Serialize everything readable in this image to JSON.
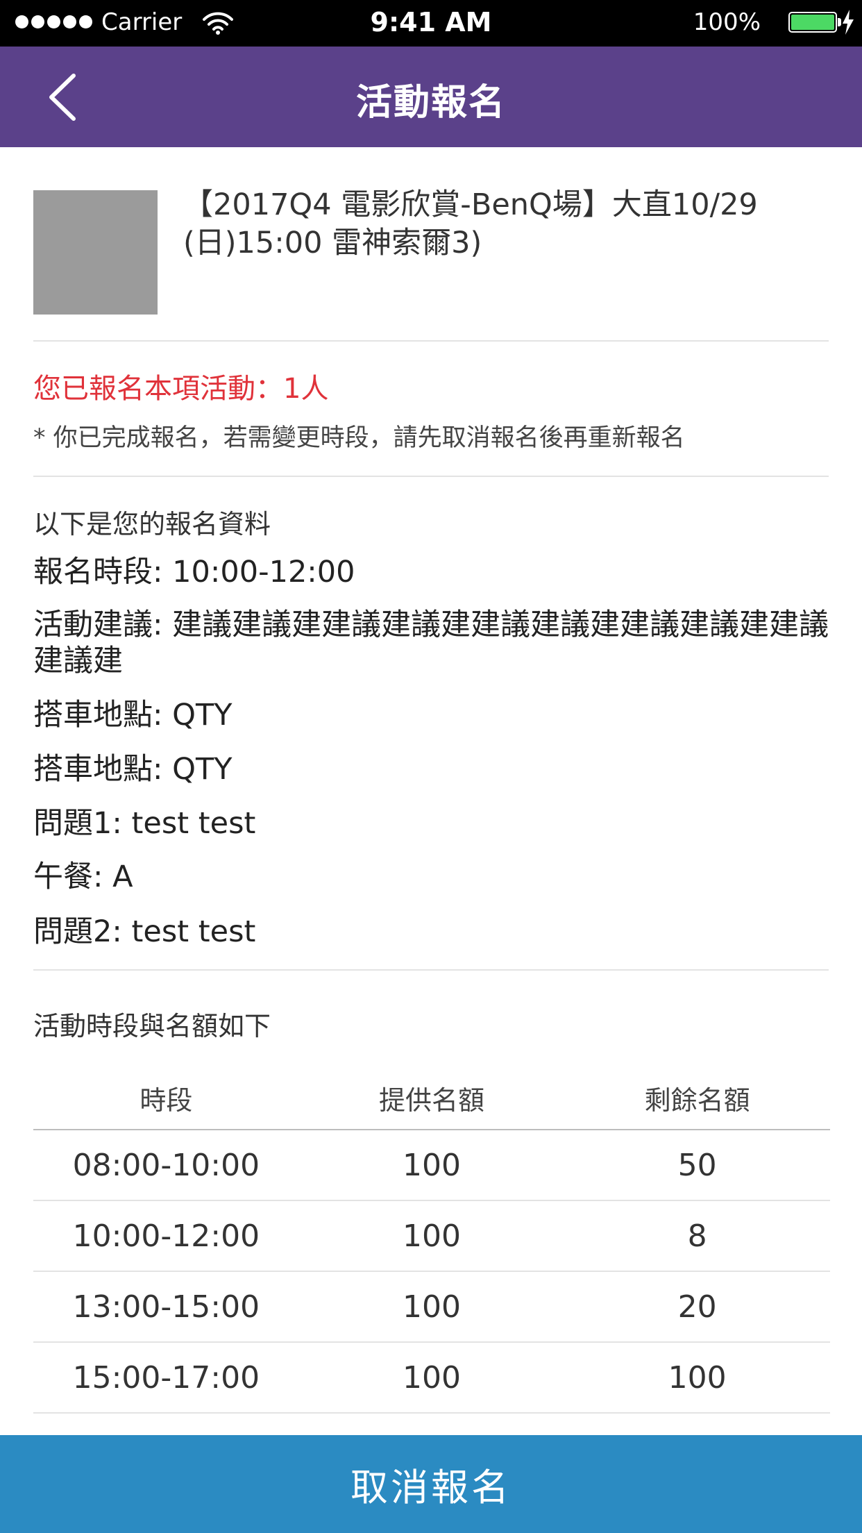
{
  "status_bar": {
    "carrier": "Carrier",
    "time": "9:41 AM",
    "battery": "100%"
  },
  "nav": {
    "title": "活動報名",
    "back_icon": "chevron-left-icon"
  },
  "event": {
    "title": "【2017Q4 電影欣賞-BenQ場】大直10/29 (日)15:00 雷神索爾3)"
  },
  "registration": {
    "status": "您已報名本項活動：1人",
    "note": "* 你已完成報名，若需變更時段，請先取消報名後再重新報名"
  },
  "details": {
    "heading": "以下是您的報名資料",
    "lines": [
      "報名時段: 10:00-12:00",
      "活動建議: 建議建議建建議建議建建議建議建建議建議建建議建議建",
      "搭車地點: QTY",
      "搭車地點: QTY",
      "問題1: test test",
      "午餐: A",
      "問題2: test test"
    ]
  },
  "slots": {
    "heading": "活動時段與名額如下",
    "columns": [
      "時段",
      "提供名額",
      "剩餘名額"
    ],
    "rows": [
      [
        "08:00-10:00",
        "100",
        "50"
      ],
      [
        "10:00-12:00",
        "100",
        "8"
      ],
      [
        "13:00-15:00",
        "100",
        "20"
      ],
      [
        "15:00-17:00",
        "100",
        "100"
      ]
    ]
  },
  "actions": {
    "cancel_label": "取消報名"
  },
  "colors": {
    "nav_bg": "#5b418a",
    "cancel_bg": "#2b8bc2",
    "alert_text": "#e0323a"
  }
}
